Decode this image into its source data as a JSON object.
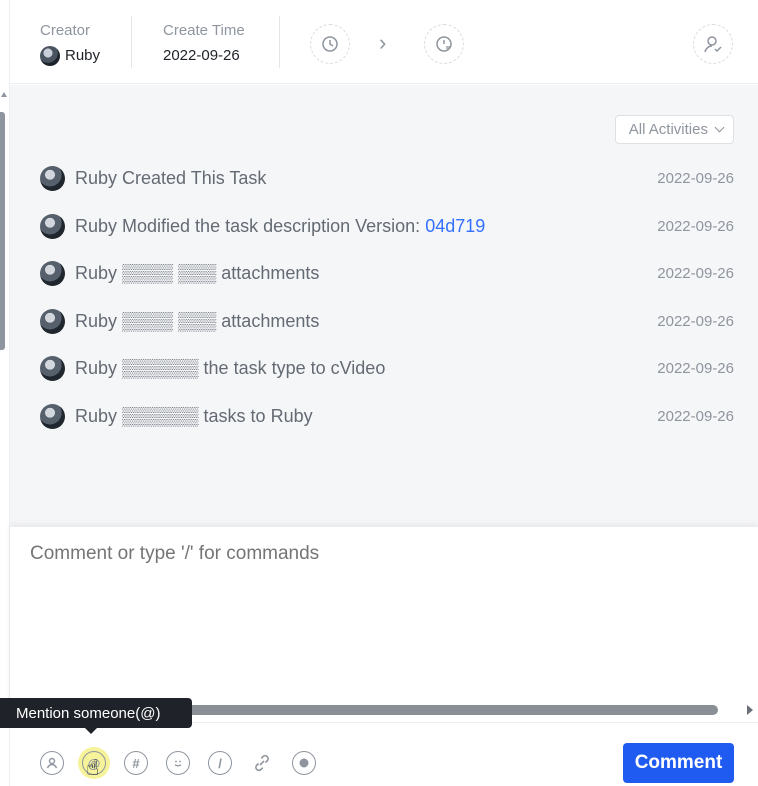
{
  "header": {
    "creator_label": "Creator",
    "creator_value": "Ruby",
    "create_time_label": "Create Time",
    "create_time_value": "2022-09-26"
  },
  "activity": {
    "filter_label": "All Activities",
    "rows": [
      {
        "text": "Ruby Created This Task",
        "link": "",
        "date": "2022-09-26"
      },
      {
        "text": "Ruby Modified the task description Version: ",
        "link": "04d719",
        "date": "2022-09-26"
      },
      {
        "text": "Ruby ▒▒▒▒ ▒▒▒ attachments",
        "link": "",
        "date": "2022-09-26"
      },
      {
        "text": "Ruby ▒▒▒▒ ▒▒▒ attachments",
        "link": "",
        "date": "2022-09-26"
      },
      {
        "text": "Ruby ▒▒▒▒▒▒ the task type to cVideo",
        "link": "",
        "date": "2022-09-26"
      },
      {
        "text": "Ruby ▒▒▒▒▒▒ tasks to Ruby",
        "link": "",
        "date": "2022-09-26"
      }
    ]
  },
  "editor": {
    "placeholder": "Comment or type '/' for commands"
  },
  "toolbar": {
    "tooltip": "Mention someone(@)",
    "comment_button": "Comment",
    "tools": [
      {
        "icon": "person-icon",
        "glyph": "⚇"
      },
      {
        "icon": "at-icon",
        "glyph": "@"
      },
      {
        "icon": "hash-icon",
        "glyph": "#"
      },
      {
        "icon": "emoji-icon",
        "glyph": "☺"
      },
      {
        "icon": "slash-icon",
        "glyph": "/"
      },
      {
        "icon": "link-icon",
        "glyph": "🔗"
      },
      {
        "icon": "record-icon",
        "glyph": "●"
      }
    ]
  },
  "colors": {
    "accent": "#1f5bf0",
    "link": "#3370ff",
    "activity_bg": "#f5f6f8"
  }
}
